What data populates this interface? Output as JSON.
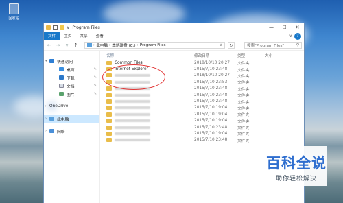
{
  "desktop": {
    "recycle_bin_label": "回收站"
  },
  "window": {
    "title": "Program Files",
    "qat_sep": "∨",
    "controls": {
      "minimize": "—",
      "maximize": "☐",
      "close": "✕"
    }
  },
  "ribbon": {
    "tabs": [
      "文件",
      "主页",
      "共享",
      "查看"
    ],
    "expand": "∨",
    "help": "?"
  },
  "address": {
    "back": "←",
    "forward": "→",
    "recent": "∨",
    "up": "↑",
    "crumbs": [
      "此电脑",
      "本地磁盘 (C:)",
      "Program Files"
    ],
    "sep": "›",
    "dropdown": "∨",
    "refresh": "↻",
    "search_placeholder": "搜索\"Program Files\"",
    "search_icon": "⚲"
  },
  "navpane": {
    "items": [
      {
        "label": "快速访问",
        "icon": "star-icon",
        "level": 0
      },
      {
        "label": "桌面",
        "icon": "desktop-icon",
        "level": 1,
        "pinned": true
      },
      {
        "label": "下载",
        "icon": "download-icon",
        "level": 1,
        "pinned": true
      },
      {
        "label": "文档",
        "icon": "document-icon",
        "level": 1,
        "pinned": true
      },
      {
        "label": "图片",
        "icon": "pictures-icon",
        "level": 1,
        "pinned": true
      },
      {
        "label": "OneDrive",
        "icon": "onedrive-icon",
        "level": 0
      },
      {
        "label": "此电脑",
        "icon": "this-pc-icon",
        "level": 0,
        "selected": true
      },
      {
        "label": "网络",
        "icon": "network-icon",
        "level": 0
      }
    ]
  },
  "columns": {
    "name": "名称",
    "date": "修改日期",
    "type": "类型",
    "size": "大小"
  },
  "files": [
    {
      "name": "Common Files",
      "date": "2018/10/10 20:27",
      "type": "文件夹"
    },
    {
      "name": "Internet Explorer",
      "date": "2015/7/10 23:48",
      "type": "文件夹"
    },
    {
      "name": "",
      "date": "2018/10/10 20:27",
      "type": "文件夹"
    },
    {
      "name": "",
      "date": "2015/7/10 23:53",
      "type": "文件夹"
    },
    {
      "name": "",
      "date": "2015/7/10 23:48",
      "type": "文件夹"
    },
    {
      "name": "",
      "date": "2015/7/10 23:48",
      "type": "文件夹"
    },
    {
      "name": "",
      "date": "2015/7/10 23:48",
      "type": "文件夹"
    },
    {
      "name": "",
      "date": "2015/7/10 19:04",
      "type": "文件夹"
    },
    {
      "name": "",
      "date": "2015/7/10 19:04",
      "type": "文件夹"
    },
    {
      "name": "",
      "date": "2015/7/10 19:04",
      "type": "文件夹"
    },
    {
      "name": "",
      "date": "2015/7/10 23:48",
      "type": "文件夹"
    },
    {
      "name": "",
      "date": "2015/7/10 19:04",
      "type": "文件夹"
    },
    {
      "name": "",
      "date": "2015/7/10 23:48",
      "type": "文件夹"
    }
  ],
  "watermark": {
    "title": "百科全说",
    "subtitle": "助你轻松解决"
  }
}
